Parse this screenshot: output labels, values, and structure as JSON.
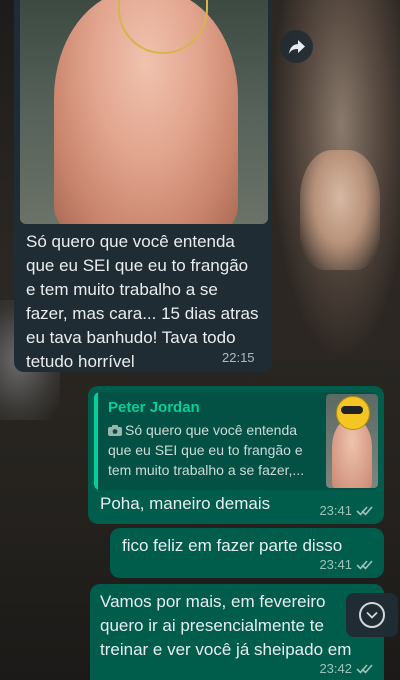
{
  "incoming": {
    "text": "Só quero que você entenda que eu SEI que eu to frangão e tem muito trabalho a se fazer, mas cara... 15 dias atras eu tava banhudo! Tava todo tetudo horrível",
    "time": "22:15"
  },
  "outgoing": [
    {
      "quote": {
        "author": "Peter Jordan",
        "text": "Só quero que você entenda que eu SEI que eu to frangão e tem muito trabalho a se fazer,..."
      },
      "text": "Poha, maneiro demais",
      "time": "23:41"
    },
    {
      "text": "fico feliz em fazer parte disso",
      "time": "23:41"
    },
    {
      "text": "Vamos por mais, em fevereiro quero ir ai presencialmente te treinar e ver você já sheipado em",
      "time": "23:42"
    }
  ],
  "icons": {
    "forward": "forward-icon",
    "camera": "camera-icon",
    "read_ticks": "double-check-icon",
    "scroll_down": "chevron-down-icon"
  },
  "colors": {
    "incoming_bubble": "#202c33",
    "outgoing_bubble": "#005c4b",
    "quote_accent": "#06cf9c"
  }
}
